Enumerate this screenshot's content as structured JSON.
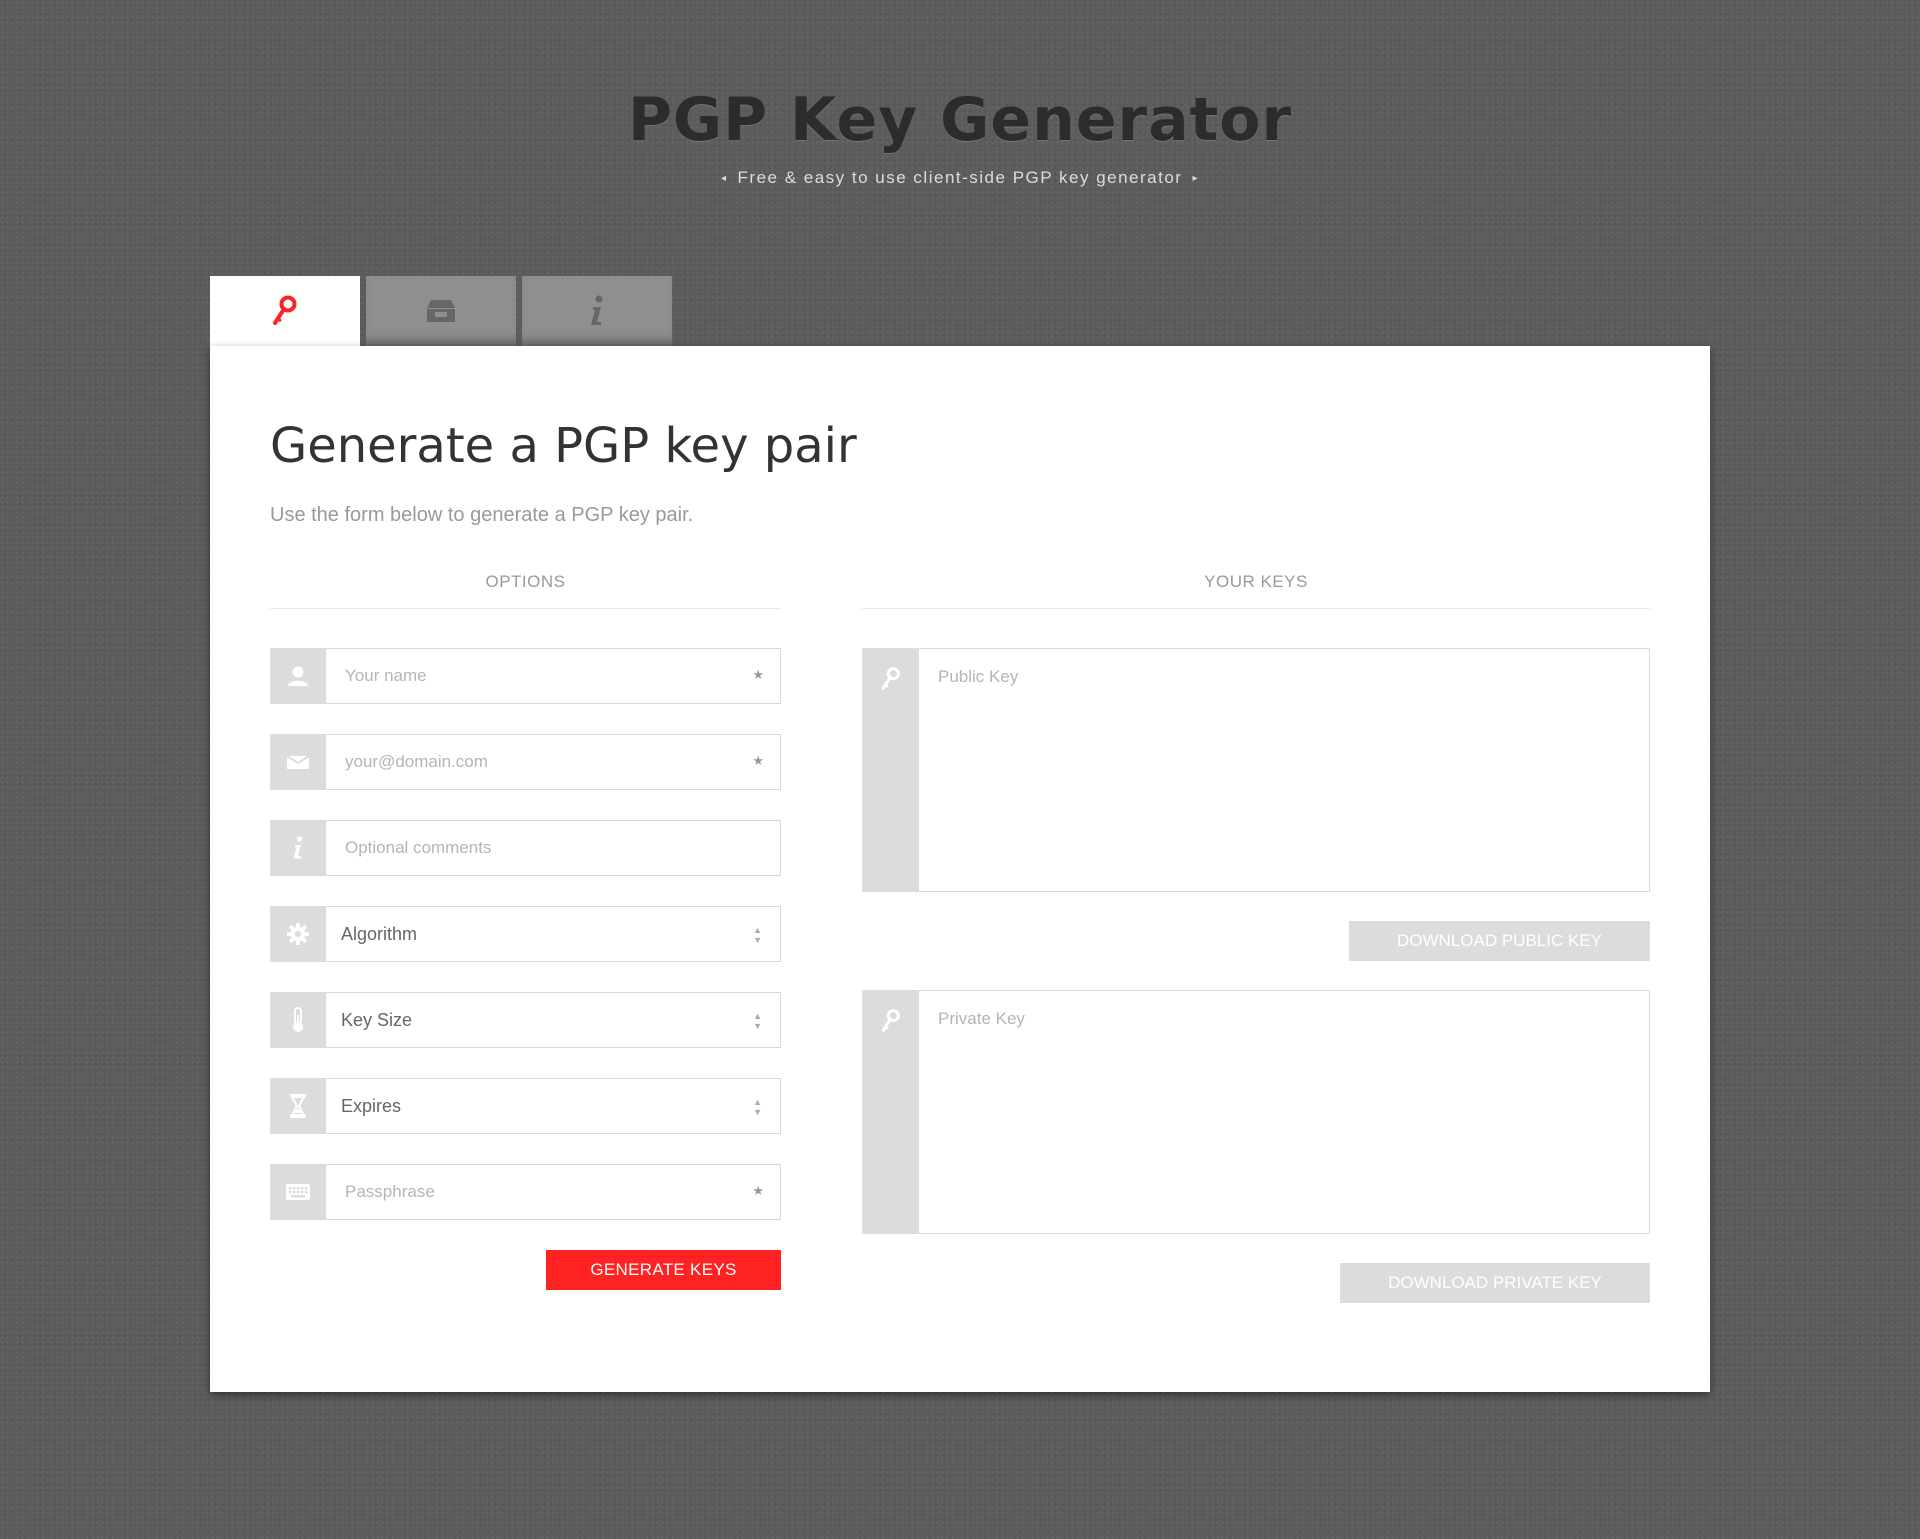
{
  "header": {
    "title": "PGP Key Generator",
    "subtitle": "Free & easy to use client-side PGP key generator"
  },
  "tabs": [
    {
      "icon": "key-icon",
      "active": true
    },
    {
      "icon": "archive-icon",
      "active": false
    },
    {
      "icon": "info-icon",
      "active": false
    }
  ],
  "main": {
    "heading": "Generate a PGP key pair",
    "lead": "Use the form below to generate a PGP key pair."
  },
  "options": {
    "title": "OPTIONS",
    "name": {
      "placeholder": "Your name",
      "required_mark": "★"
    },
    "email": {
      "placeholder": "your@domain.com",
      "required_mark": "★"
    },
    "comments": {
      "placeholder": "Optional comments"
    },
    "algorithm": {
      "label": "Algorithm"
    },
    "key_size": {
      "label": "Key Size"
    },
    "expires": {
      "label": "Expires"
    },
    "passphrase": {
      "placeholder": "Passphrase",
      "required_mark": "★"
    },
    "generate_label": "GENERATE KEYS"
  },
  "keys": {
    "title": "YOUR KEYS",
    "public_placeholder": "Public Key",
    "private_placeholder": "Private Key",
    "download_public_label": "DOWNLOAD PUBLIC KEY",
    "download_private_label": "DOWNLOAD PRIVATE KEY"
  },
  "colors": {
    "accent": "#ff2222",
    "background": "#5c5c5c",
    "addon": "#dcdcdc",
    "disabled_button": "#dcdcdc"
  }
}
